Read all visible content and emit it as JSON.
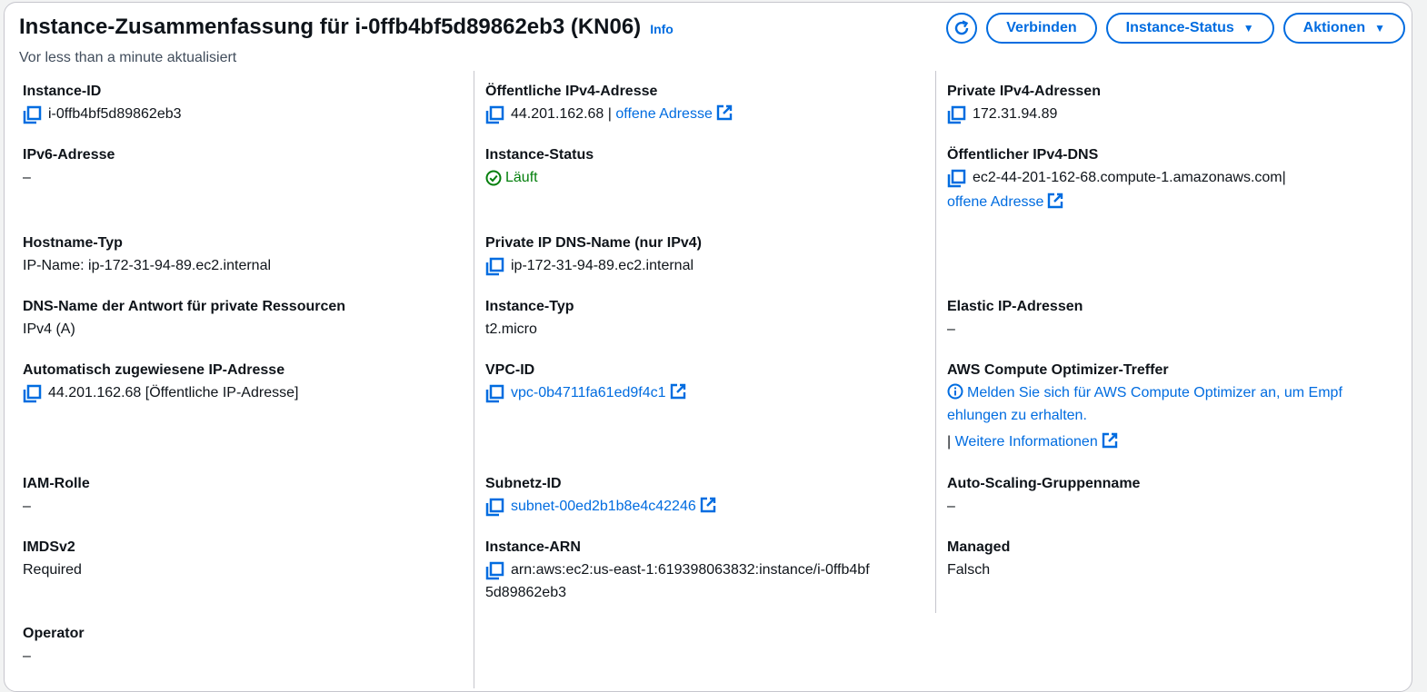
{
  "header": {
    "title": "Instance-Zusammenfassung für i-0ffb4bf5d89862eb3 (KN06)",
    "info": "Info",
    "subtitle": "Vor less than a minute aktualisiert"
  },
  "actions": {
    "connect": "Verbinden",
    "instance_status": "Instance-Status",
    "actions": "Aktionen"
  },
  "col1": {
    "instance_id": {
      "label": "Instance-ID",
      "value": "i-0ffb4bf5d89862eb3"
    },
    "ipv6": {
      "label": "IPv6-Adresse",
      "value": "–"
    },
    "hostname_type": {
      "label": "Hostname-Typ",
      "value": "IP-Name: ip-172-31-94-89.ec2.internal"
    },
    "dns_answer": {
      "label": "DNS-Name der Antwort für private Ressourcen",
      "value": "IPv4 (A)"
    },
    "auto_ip": {
      "label": "Automatisch zugewiesene IP-Adresse",
      "value": "44.201.162.68 [Öffentliche IP-Adresse]"
    },
    "iam_role": {
      "label": "IAM-Rolle",
      "value": "–"
    },
    "imdsv2": {
      "label": "IMDSv2",
      "value": "Required"
    },
    "operator": {
      "label": "Operator",
      "value": "–"
    }
  },
  "col2": {
    "public_ipv4": {
      "label": "Öffentliche IPv4-Adresse",
      "value": "44.201.162.68",
      "separator": "|",
      "link": "offene Adresse"
    },
    "instance_status": {
      "label": "Instance-Status",
      "value": "Läuft"
    },
    "private_dns": {
      "label": "Private IP DNS-Name (nur IPv4)",
      "value": "ip-172-31-94-89.ec2.internal"
    },
    "instance_type": {
      "label": "Instance-Typ",
      "value": "t2.micro"
    },
    "vpc_id": {
      "label": "VPC-ID",
      "value": "vpc-0b4711fa61ed9f4c1"
    },
    "subnet_id": {
      "label": "Subnetz-ID",
      "value": "subnet-00ed2b1b8e4c42246"
    },
    "instance_arn": {
      "label": "Instance-ARN",
      "value_line1": "arn:aws:ec2:us-east-1:619398063832:instance/i-0ffb4bf",
      "value_line2": "5d89862eb3"
    }
  },
  "col3": {
    "private_ipv4": {
      "label": "Private IPv4-Adressen",
      "value": "172.31.94.89"
    },
    "public_dns": {
      "label": "Öffentlicher IPv4-DNS",
      "value": "ec2-44-201-162-68.compute-1.amazonaws.com",
      "separator": "|",
      "link": "offene Adresse"
    },
    "elastic_ip": {
      "label": "Elastic IP-Adressen",
      "value": "–"
    },
    "optimizer": {
      "label": "AWS Compute Optimizer-Treffer",
      "line1": "Melden Sie sich für AWS Compute Optimizer an, um Empf",
      "line2": "ehlungen zu erhalten.",
      "separator": "|",
      "more": "Weitere Informationen"
    },
    "asg_name": {
      "label": "Auto-Scaling-Gruppenname",
      "value": "–"
    },
    "managed": {
      "label": "Managed",
      "value": "Falsch"
    }
  },
  "colors": {
    "accent": "#006ce0",
    "success": "#037f0c",
    "divider": "#c6c6cd"
  }
}
